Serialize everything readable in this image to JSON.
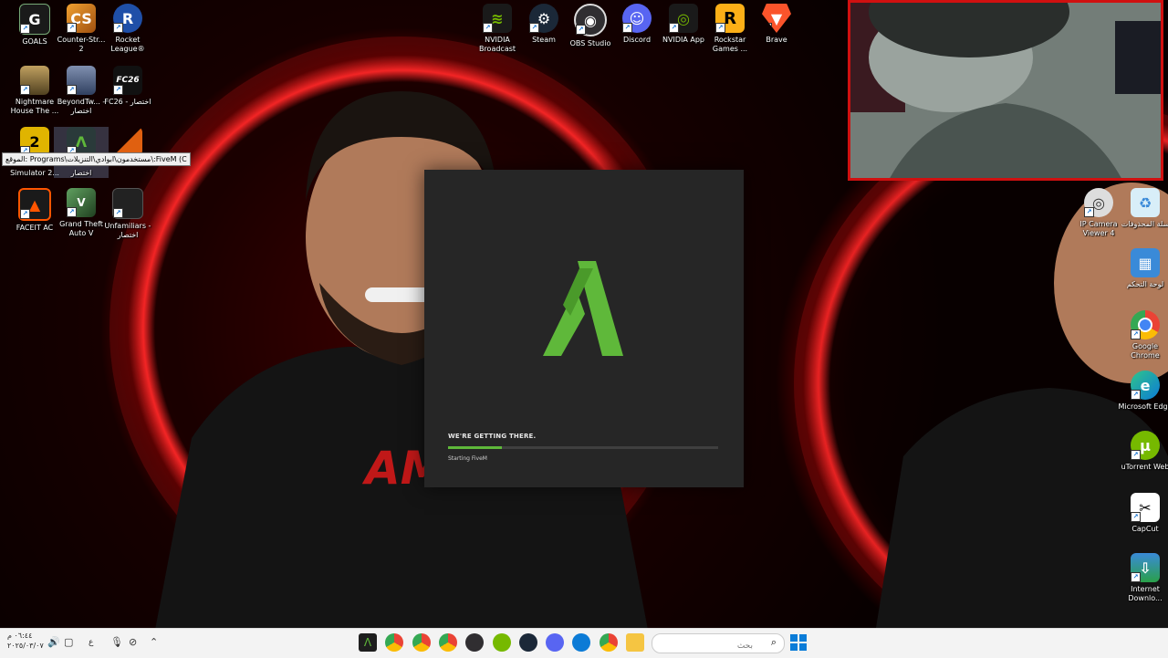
{
  "desktop_icons_left": [
    {
      "label": "GOALS",
      "icon": "goals-icon",
      "color": "#1a1a1a"
    },
    {
      "label": "Counter-Str... 2",
      "icon": "counter-strike-icon",
      "color": "#d68a1f"
    },
    {
      "label": "Rocket League®",
      "icon": "rocket-league-icon",
      "color": "#1f4fa8"
    },
    {
      "label": "Nightmare House The ...",
      "icon": "nightmare-house-icon",
      "color": "#8a7a4a"
    },
    {
      "label": "BeyondTw... - اختصار",
      "icon": "beyond-two-souls-icon",
      "color": "#4a5a7a"
    },
    {
      "label": "FC26 - اختصار",
      "icon": "fc26-icon",
      "color": "#111111"
    },
    {
      "label": "Simulator 2...",
      "icon": "simulator-icon",
      "color": "#e0b400"
    },
    {
      "label": "اختصار",
      "icon": "fivem-shortcut-icon",
      "color": "#2a3a3a"
    },
    {
      "label": "",
      "icon": "orange-app-icon",
      "color": "#e06010"
    },
    {
      "label": "FACEIT AC",
      "icon": "faceit-icon",
      "color": "#ff5500"
    },
    {
      "label": "Grand Theft Auto V",
      "icon": "gta-v-icon",
      "color": "#3a6a3a"
    },
    {
      "label": "Unfamiliars - اختصار",
      "icon": "unfamiliars-icon",
      "color": "#222222"
    }
  ],
  "desktop_icons_top": [
    {
      "label": "NVIDIA Broadcast",
      "icon": "nvidia-broadcast-icon",
      "color": "#76b900"
    },
    {
      "label": "Steam",
      "icon": "steam-icon",
      "color": "#1b2838"
    },
    {
      "label": "OBS Studio",
      "icon": "obs-icon",
      "color": "#302e31"
    },
    {
      "label": "Discord",
      "icon": "discord-icon",
      "color": "#5865f2"
    },
    {
      "label": "NVIDIA App",
      "icon": "nvidia-app-icon",
      "color": "#76b900"
    },
    {
      "label": "Rockstar Games ...",
      "icon": "rockstar-icon",
      "color": "#fcaf17"
    },
    {
      "label": "Brave",
      "icon": "brave-icon",
      "color": "#fb542b"
    }
  ],
  "desktop_icons_right": [
    {
      "label": "IP Camera Viewer 4",
      "icon": "ip-camera-icon",
      "color": "#cccccc"
    },
    {
      "label": "سلة المحذوفات",
      "icon": "recycle-bin-icon",
      "color": "#b0d8f0"
    },
    {
      "label": "لوحة التحكم",
      "icon": "control-panel-icon",
      "color": "#3a8ad8"
    },
    {
      "label": "Google Chrome",
      "icon": "chrome-icon",
      "color": "#4285f4"
    },
    {
      "label": "Microsoft Edge",
      "icon": "edge-icon",
      "color": "#0c7bd6"
    },
    {
      "label": "uTorrent Web",
      "icon": "utorrent-icon",
      "color": "#76b900"
    },
    {
      "label": "CapCut",
      "icon": "capcut-icon",
      "color": "#ffffff"
    },
    {
      "label": "Internet Downlo...",
      "icon": "internet-download-manager-icon",
      "color": "#2aa04a"
    }
  ],
  "tooltip": "الموقع: Programs\\مستخدمون\\ابوادي\\التنزيلات\\:FiveM (C",
  "splash": {
    "app": "FiveM",
    "loading_title": "WE'RE GETTING THERE.",
    "status": "Starting FiveM",
    "progress": 0.2,
    "accent": "#5fb83a"
  },
  "taskbar": {
    "search_placeholder": "بحث",
    "apps": [
      {
        "icon": "fivem-icon",
        "color": "#1e1e1e"
      },
      {
        "icon": "chrome-icon",
        "color": "#4285f4"
      },
      {
        "icon": "chrome-icon",
        "color": "#4285f4"
      },
      {
        "icon": "chrome-icon",
        "color": "#4285f4"
      },
      {
        "icon": "obs-icon",
        "color": "#302e31"
      },
      {
        "icon": "utorrent-icon",
        "color": "#76b900"
      },
      {
        "icon": "steam-icon",
        "color": "#1b2838"
      },
      {
        "icon": "discord-icon",
        "color": "#5865f2"
      },
      {
        "icon": "edge-icon",
        "color": "#0c7bd6"
      },
      {
        "icon": "chrome-icon",
        "color": "#4285f4"
      },
      {
        "icon": "file-explorer-icon",
        "color": "#f5c542"
      }
    ],
    "clock_time": "٠٦:٤٤ م",
    "clock_date": "٢٠٢٥/٠٣/٠٧",
    "language": "ع"
  }
}
